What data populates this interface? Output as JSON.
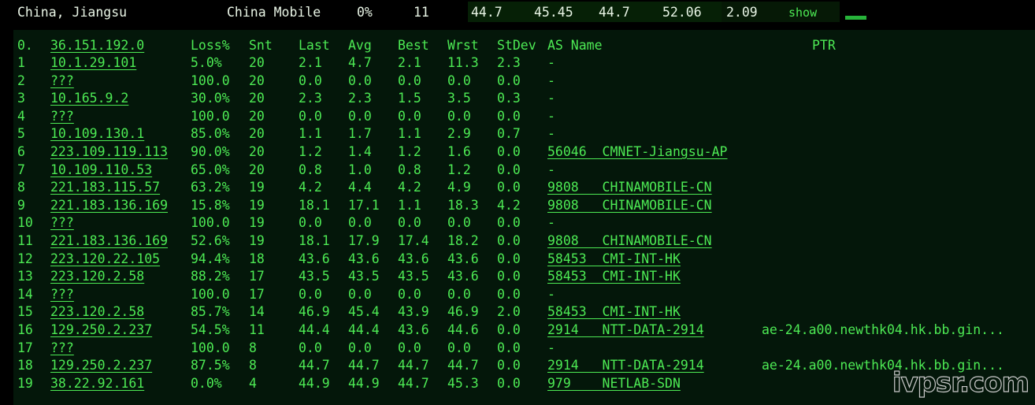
{
  "summary": {
    "location": "China, Jiangsu",
    "isp": "China Mobile",
    "loss": "0%",
    "snt": "11",
    "last": "44.7",
    "avg": "45.45",
    "best": "44.7",
    "wrst": "52.06",
    "stdev": "2.09",
    "show_label": "show",
    "colors": {
      "text": "#e9f5e6",
      "accent": "#4dea54",
      "badge": "#27b33a"
    }
  },
  "table": {
    "headers": {
      "index": "0.",
      "host": "36.151.192.0",
      "loss": "Loss%",
      "snt": "Snt",
      "last": "Last",
      "avg": "Avg",
      "best": "Best",
      "wrst": "Wrst",
      "stdev": "StDev",
      "as": "AS Name",
      "ptr": "PTR"
    },
    "rows": [
      {
        "i": "1",
        "host": "10.1.29.101",
        "loss": "5.0%",
        "snt": "20",
        "last": "2.1",
        "avg": "4.7",
        "best": "2.1",
        "wrst": "11.3",
        "std": "2.3",
        "as": "-",
        "ptr": ""
      },
      {
        "i": "2",
        "host": "???",
        "loss": "100.0",
        "snt": "20",
        "last": "0.0",
        "avg": "0.0",
        "best": "0.0",
        "wrst": "0.0",
        "std": "0.0",
        "as": "-",
        "ptr": ""
      },
      {
        "i": "3",
        "host": "10.165.9.2",
        "loss": "30.0%",
        "snt": "20",
        "last": "2.3",
        "avg": "2.3",
        "best": "1.5",
        "wrst": "3.5",
        "std": "0.3",
        "as": "-",
        "ptr": ""
      },
      {
        "i": "4",
        "host": "???",
        "loss": "100.0",
        "snt": "20",
        "last": "0.0",
        "avg": "0.0",
        "best": "0.0",
        "wrst": "0.0",
        "std": "0.0",
        "as": "-",
        "ptr": ""
      },
      {
        "i": "5",
        "host": "10.109.130.1",
        "loss": "85.0%",
        "snt": "20",
        "last": "1.1",
        "avg": "1.7",
        "best": "1.1",
        "wrst": "2.9",
        "std": "0.7",
        "as": "-",
        "ptr": ""
      },
      {
        "i": "6",
        "host": "223.109.119.113",
        "loss": "90.0%",
        "snt": "20",
        "last": "1.2",
        "avg": "1.4",
        "best": "1.2",
        "wrst": "1.6",
        "std": "0.0",
        "as": "56046  CMNET-Jiangsu-AP",
        "ptr": ""
      },
      {
        "i": "7",
        "host": "10.109.110.53",
        "loss": "65.0%",
        "snt": "20",
        "last": "0.8",
        "avg": "1.0",
        "best": "0.8",
        "wrst": "1.2",
        "std": "0.0",
        "as": "-",
        "ptr": ""
      },
      {
        "i": "8",
        "host": "221.183.115.57",
        "loss": "63.2%",
        "snt": "19",
        "last": "4.2",
        "avg": "4.4",
        "best": "4.2",
        "wrst": "4.9",
        "std": "0.0",
        "as": "9808   CHINAMOBILE-CN",
        "ptr": ""
      },
      {
        "i": "9",
        "host": "221.183.136.169",
        "loss": "15.8%",
        "snt": "19",
        "last": "18.1",
        "avg": "17.1",
        "best": "1.1",
        "wrst": "18.3",
        "std": "4.2",
        "as": "9808   CHINAMOBILE-CN",
        "ptr": ""
      },
      {
        "i": "10",
        "host": "???",
        "loss": "100.0",
        "snt": "19",
        "last": "0.0",
        "avg": "0.0",
        "best": "0.0",
        "wrst": "0.0",
        "std": "0.0",
        "as": "-",
        "ptr": ""
      },
      {
        "i": "11",
        "host": "221.183.136.169",
        "loss": "52.6%",
        "snt": "19",
        "last": "18.1",
        "avg": "17.9",
        "best": "17.4",
        "wrst": "18.2",
        "std": "0.0",
        "as": "9808   CHINAMOBILE-CN",
        "ptr": ""
      },
      {
        "i": "12",
        "host": "223.120.22.105",
        "loss": "94.4%",
        "snt": "18",
        "last": "43.6",
        "avg": "43.6",
        "best": "43.6",
        "wrst": "43.6",
        "std": "0.0",
        "as": "58453  CMI-INT-HK",
        "ptr": ""
      },
      {
        "i": "13",
        "host": "223.120.2.58",
        "loss": "88.2%",
        "snt": "17",
        "last": "43.5",
        "avg": "43.5",
        "best": "43.5",
        "wrst": "43.6",
        "std": "0.0",
        "as": "58453  CMI-INT-HK",
        "ptr": ""
      },
      {
        "i": "14",
        "host": "???",
        "loss": "100.0",
        "snt": "17",
        "last": "0.0",
        "avg": "0.0",
        "best": "0.0",
        "wrst": "0.0",
        "std": "0.0",
        "as": "-",
        "ptr": ""
      },
      {
        "i": "15",
        "host": "223.120.2.58",
        "loss": "85.7%",
        "snt": "14",
        "last": "46.9",
        "avg": "45.4",
        "best": "43.9",
        "wrst": "46.9",
        "std": "2.0",
        "as": "58453  CMI-INT-HK",
        "ptr": ""
      },
      {
        "i": "16",
        "host": "129.250.2.237",
        "loss": "54.5%",
        "snt": "11",
        "last": "44.4",
        "avg": "44.4",
        "best": "43.6",
        "wrst": "44.6",
        "std": "0.0",
        "as": "2914   NTT-DATA-2914",
        "ptr": "ae-24.a00.newthk04.hk.bb.gin..."
      },
      {
        "i": "17",
        "host": "???",
        "loss": "100.0",
        "snt": "8",
        "last": "0.0",
        "avg": "0.0",
        "best": "0.0",
        "wrst": "0.0",
        "std": "0.0",
        "as": "-",
        "ptr": ""
      },
      {
        "i": "18",
        "host": "129.250.2.237",
        "loss": "87.5%",
        "snt": "8",
        "last": "44.7",
        "avg": "44.7",
        "best": "44.7",
        "wrst": "44.7",
        "std": "0.0",
        "as": "2914   NTT-DATA-2914",
        "ptr": "ae-24.a00.newthk04.hk.bb.gin..."
      },
      {
        "i": "19",
        "host": "38.22.92.161",
        "loss": "0.0%",
        "snt": "4",
        "last": "44.9",
        "avg": "44.9",
        "best": "44.7",
        "wrst": "45.3",
        "std": "0.0",
        "as": "979    NETLAB-SDN",
        "ptr": ""
      }
    ]
  },
  "watermark": "ivpsr.com"
}
